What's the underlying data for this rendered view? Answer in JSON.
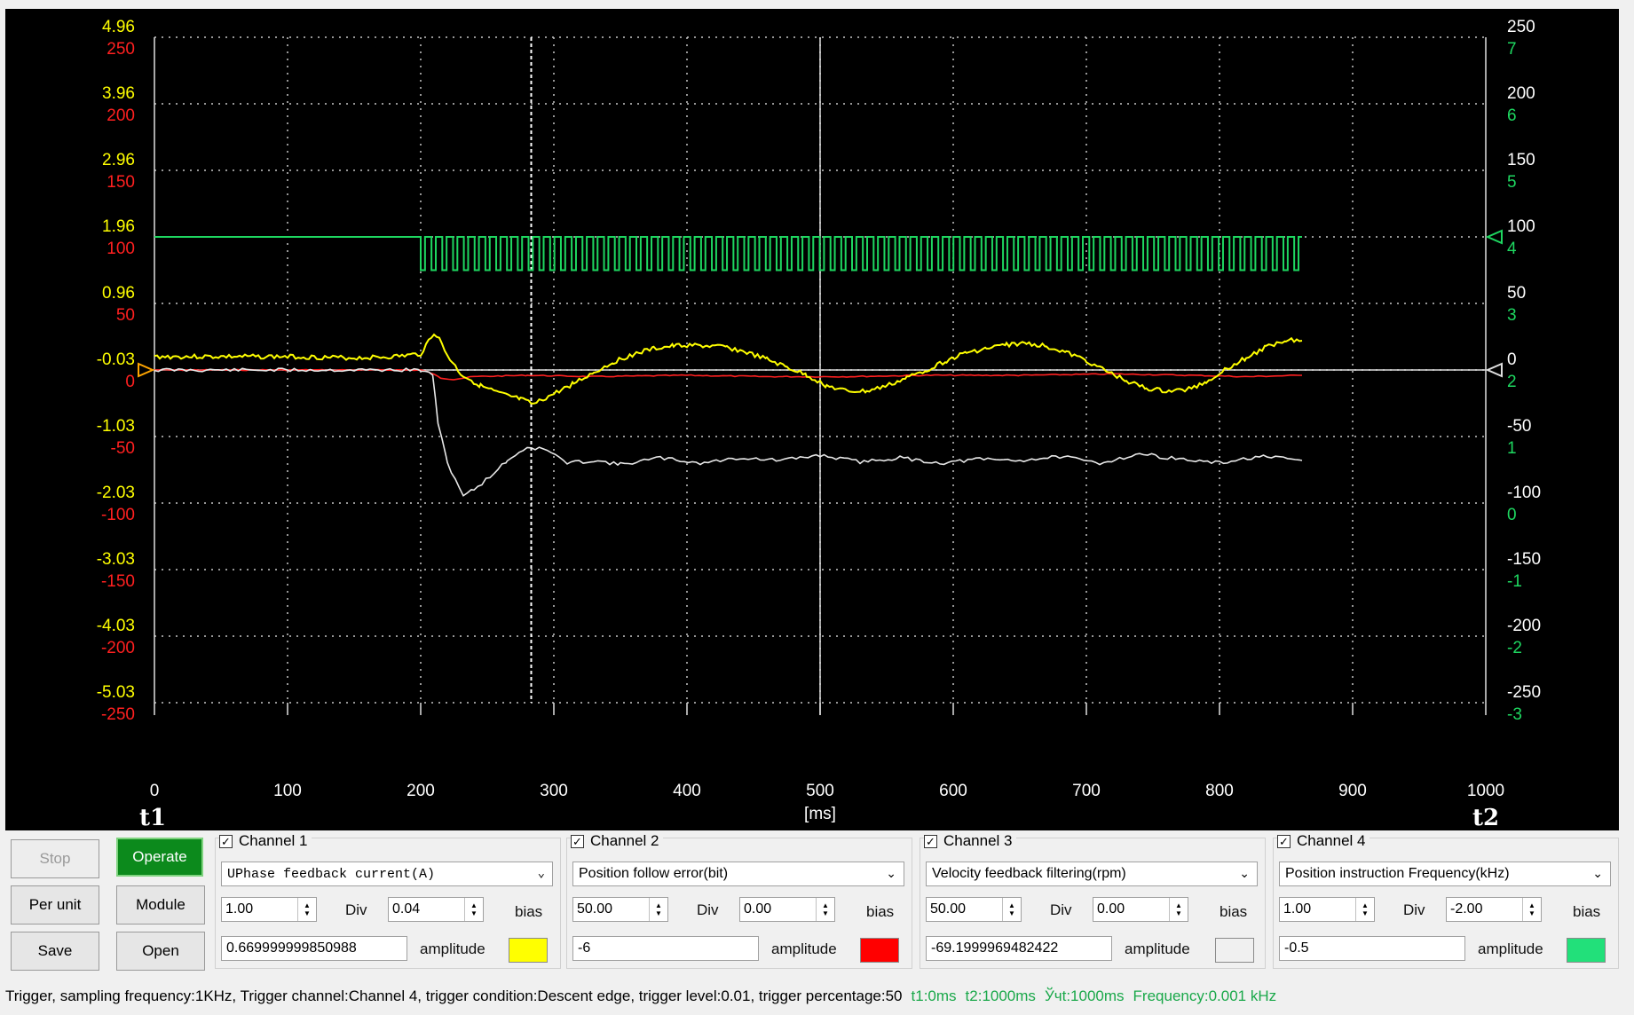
{
  "chart_data": {
    "type": "line",
    "x_ticks": [
      "0",
      "100",
      "200",
      "300",
      "400",
      "500",
      "600",
      "700",
      "800",
      "900",
      "1000"
    ],
    "xlim": [
      0,
      1000
    ],
    "xlabel": "[ms]",
    "cursor_labels": [
      "t1",
      "t2"
    ],
    "left_axis_ch1_ticks": [
      "4.96",
      "3.96",
      "2.96",
      "1.96",
      "0.96",
      "-0.03",
      "-1.03",
      "-2.03",
      "-3.03",
      "-4.03",
      "-5.03"
    ],
    "left_axis_ch2_ticks": [
      "250",
      "200",
      "150",
      "100",
      "50",
      "0",
      "-50",
      "-100",
      "-150",
      "-200",
      "-250"
    ],
    "right_axis_ch3_ticks": [
      "250",
      "200",
      "150",
      "100",
      "50",
      "0",
      "-50",
      "-100",
      "-150",
      "-200",
      "-250"
    ],
    "right_axis_ch4_ticks": [
      "7",
      "6",
      "5",
      "4",
      "3",
      "2",
      "1",
      "0",
      "-1",
      "-2",
      "-3"
    ],
    "cursor_x": 283,
    "series": [
      {
        "name": "Channel 1",
        "color": "#ffff00",
        "unit_scale": "volts-per-division axis (ch1)",
        "points": [
          [
            0,
            0.16
          ],
          [
            50,
            0.16
          ],
          [
            100,
            0.16
          ],
          [
            150,
            0.14
          ],
          [
            180,
            0.16
          ],
          [
            200,
            0.2
          ],
          [
            206,
            0.4
          ],
          [
            210,
            0.52
          ],
          [
            214,
            0.42
          ],
          [
            220,
            0.18
          ],
          [
            230,
            -0.1
          ],
          [
            245,
            -0.28
          ],
          [
            260,
            -0.4
          ],
          [
            275,
            -0.48
          ],
          [
            285,
            -0.56
          ],
          [
            292,
            -0.48
          ],
          [
            300,
            -0.4
          ],
          [
            315,
            -0.24
          ],
          [
            330,
            -0.08
          ],
          [
            345,
            0.08
          ],
          [
            360,
            0.2
          ],
          [
            375,
            0.28
          ],
          [
            390,
            0.32
          ],
          [
            400,
            0.33
          ],
          [
            415,
            0.32
          ],
          [
            430,
            0.3
          ],
          [
            445,
            0.22
          ],
          [
            460,
            0.12
          ],
          [
            475,
            0.0
          ],
          [
            490,
            -0.12
          ],
          [
            505,
            -0.28
          ],
          [
            520,
            -0.36
          ],
          [
            535,
            -0.36
          ],
          [
            550,
            -0.28
          ],
          [
            565,
            -0.16
          ],
          [
            580,
            -0.04
          ],
          [
            595,
            0.1
          ],
          [
            610,
            0.22
          ],
          [
            625,
            0.28
          ],
          [
            640,
            0.34
          ],
          [
            655,
            0.36
          ],
          [
            670,
            0.32
          ],
          [
            685,
            0.22
          ],
          [
            700,
            0.1
          ],
          [
            715,
            -0.06
          ],
          [
            730,
            -0.2
          ],
          [
            745,
            -0.32
          ],
          [
            760,
            -0.36
          ],
          [
            775,
            -0.34
          ],
          [
            790,
            -0.22
          ],
          [
            805,
            -0.02
          ],
          [
            820,
            0.14
          ],
          [
            835,
            0.3
          ],
          [
            850,
            0.42
          ],
          [
            862,
            0.4
          ]
        ]
      },
      {
        "name": "Channel 2",
        "color": "#ff2020",
        "points": [
          [
            0,
            0
          ],
          [
            200,
            0
          ],
          [
            207,
            -2
          ],
          [
            215,
            -6
          ],
          [
            225,
            -7
          ],
          [
            240,
            -5
          ],
          [
            280,
            -4
          ],
          [
            330,
            -5
          ],
          [
            400,
            -4
          ],
          [
            460,
            -5
          ],
          [
            520,
            -5
          ],
          [
            580,
            -4
          ],
          [
            650,
            -4
          ],
          [
            720,
            -3
          ],
          [
            780,
            -4
          ],
          [
            820,
            -5
          ],
          [
            862,
            -4
          ]
        ]
      },
      {
        "name": "Channel 3",
        "color": "#e8e8e8",
        "points": [
          [
            0,
            0
          ],
          [
            200,
            0
          ],
          [
            209,
            -4
          ],
          [
            211,
            -20
          ],
          [
            213,
            -40
          ],
          [
            220,
            -70
          ],
          [
            232,
            -94
          ],
          [
            240,
            -90
          ],
          [
            252,
            -80
          ],
          [
            265,
            -68
          ],
          [
            280,
            -58
          ],
          [
            295,
            -60
          ],
          [
            310,
            -70
          ],
          [
            330,
            -68
          ],
          [
            350,
            -71
          ],
          [
            380,
            -66
          ],
          [
            410,
            -70
          ],
          [
            440,
            -66
          ],
          [
            470,
            -68
          ],
          [
            500,
            -64
          ],
          [
            530,
            -69
          ],
          [
            560,
            -66
          ],
          [
            590,
            -70
          ],
          [
            620,
            -67
          ],
          [
            650,
            -68
          ],
          [
            680,
            -65
          ],
          [
            710,
            -70
          ],
          [
            740,
            -63
          ],
          [
            770,
            -67
          ],
          [
            800,
            -70
          ],
          [
            830,
            -65
          ],
          [
            862,
            -68
          ]
        ]
      },
      {
        "name": "Channel 4",
        "color": "#1ed760",
        "baseline": 0,
        "pulse_low": -0.5,
        "pulse_start": 200,
        "pulse_end": 862,
        "pulse_period": 8.1
      }
    ]
  },
  "buttons": {
    "stop": "Stop",
    "operate": "Operate",
    "per_unit": "Per unit",
    "module": "Module",
    "save": "Save",
    "open": "Open"
  },
  "channels": [
    {
      "title": "Channel 1",
      "checked": "✓",
      "signal": "UPhase feedback current(A)",
      "div": "1.00",
      "div_label": "Div",
      "bias": "0.04",
      "bias_label": "bias",
      "amplitude": "0.669999999850988",
      "amplitude_label": "amplitude",
      "color": "#ffff00"
    },
    {
      "title": "Channel 2",
      "checked": "✓",
      "signal": "Position follow error(bit)",
      "div": "50.00",
      "div_label": "Div",
      "bias": "0.00",
      "bias_label": "bias",
      "amplitude": "-6",
      "amplitude_label": "amplitude",
      "color": "#ff0000"
    },
    {
      "title": "Channel 3",
      "checked": "✓",
      "signal": "Velocity feedback filtering(rpm)",
      "div": "50.00",
      "div_label": "Div",
      "bias": "0.00",
      "bias_label": "bias",
      "amplitude": "-69.1999969482422",
      "amplitude_label": "amplitude",
      "color": "#f0f0f0"
    },
    {
      "title": "Channel 4",
      "checked": "✓",
      "signal": "Position instruction Frequency(kHz)",
      "div": "1.00",
      "div_label": "Div",
      "bias": "-2.00",
      "bias_label": "bias",
      "amplitude": "-0.5",
      "amplitude_label": "amplitude",
      "color": "#22e07a"
    }
  ],
  "status": {
    "trigger": "Trigger, sampling frequency:1KHz, Trigger channel:Channel 4, trigger condition:Descent edge, trigger level:0.01, trigger percentage:50",
    "t1": "t1:0ms",
    "t2": "t2:1000ms",
    "dt": "Ўчt:1000ms",
    "frequency": "Frequency:0.001 kHz"
  },
  "colors": {
    "ch1_axis": "#ffff00",
    "ch2_axis": "#ff2020",
    "ch3_axis": "#ffffff",
    "ch4_axis": "#1ed760",
    "background": "#000000",
    "grid": "#c8c8c8"
  }
}
